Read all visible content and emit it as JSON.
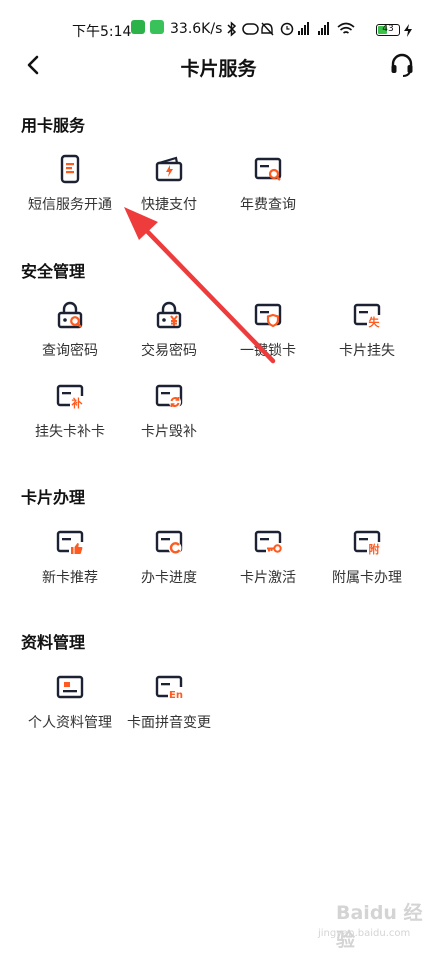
{
  "status_bar": {
    "time": "下午5:14",
    "network_speed": "33.6K/s",
    "battery": "43"
  },
  "header": {
    "title": "卡片服务",
    "back_icon": "chevron-left-icon",
    "service_icon": "headset-icon"
  },
  "sections": [
    {
      "title": "用卡服务",
      "items": [
        {
          "label": "短信服务开通",
          "icon": "sms-phone-icon"
        },
        {
          "label": "快捷支付",
          "icon": "wallet-lightning-icon"
        },
        {
          "label": "年费查询",
          "icon": "card-search-icon"
        }
      ]
    },
    {
      "title": "安全管理",
      "items": [
        {
          "label": "查询密码",
          "icon": "lock-search-icon"
        },
        {
          "label": "交易密码",
          "icon": "lock-yen-icon"
        },
        {
          "label": "一键锁卡",
          "icon": "card-shield-icon"
        },
        {
          "label": "卡片挂失",
          "icon": "card-lost-icon"
        },
        {
          "label": "挂失卡补卡",
          "icon": "card-replace-icon"
        },
        {
          "label": "卡片毁补",
          "icon": "card-refresh-icon"
        }
      ]
    },
    {
      "title": "卡片办理",
      "items": [
        {
          "label": "新卡推荐",
          "icon": "card-thumbs-up-icon"
        },
        {
          "label": "办卡进度",
          "icon": "card-progress-icon"
        },
        {
          "label": "卡片激活",
          "icon": "card-key-icon"
        },
        {
          "label": "附属卡办理",
          "icon": "card-supplementary-icon"
        }
      ]
    },
    {
      "title": "资料管理",
      "items": [
        {
          "label": "个人资料管理",
          "icon": "id-card-icon"
        },
        {
          "label": "卡面拼音变更",
          "icon": "card-pinyin-icon"
        }
      ]
    }
  ],
  "badges": {
    "lost": "失",
    "replace": "补",
    "supplementary": "附",
    "pinyin": "En"
  },
  "watermark": {
    "brand": "Baidu 经验",
    "url": "jingyan.baidu.com"
  },
  "colors": {
    "accent": "#ff5a1f",
    "icon_dark": "#1c2233",
    "annotation_arrow": "#ee3b3b"
  }
}
